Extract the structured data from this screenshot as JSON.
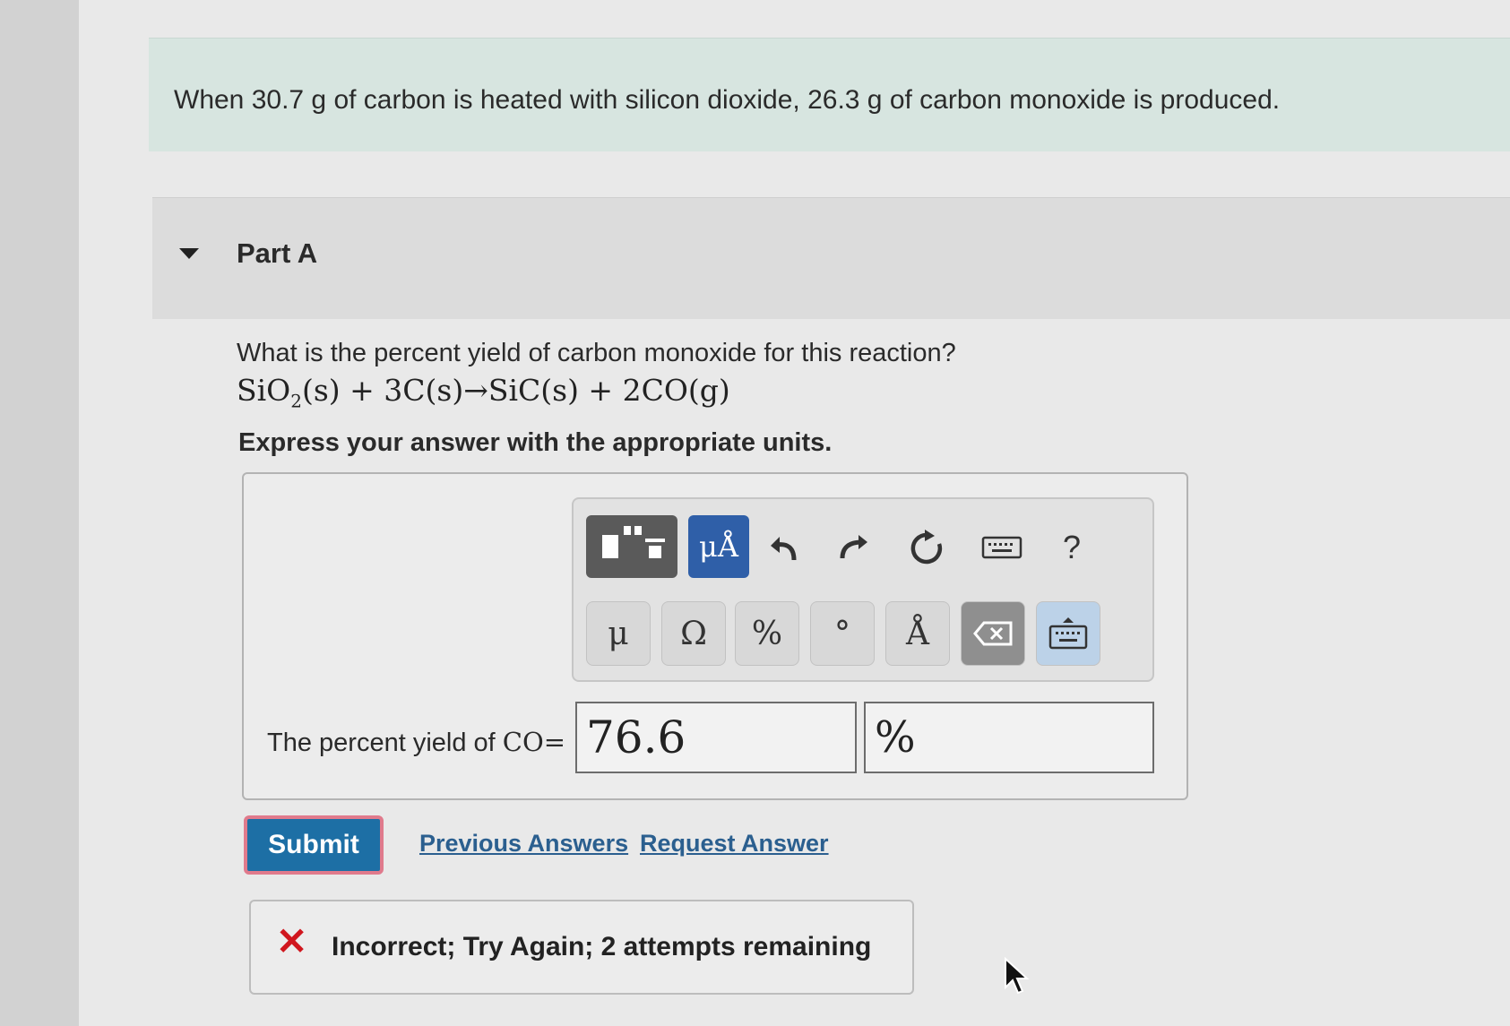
{
  "problem": {
    "text": "When 30.7 g of carbon is heated with silicon dioxide, 26.3 g of carbon monoxide is produced."
  },
  "part": {
    "title": "Part A",
    "question": "What is the percent yield of carbon monoxide for this reaction?",
    "equation_pre": "SiO",
    "equation_sub": "2",
    "equation_post": "(s) + 3C(s)→SiC(s) + 2CO(g)",
    "instructions": "Express your answer with the appropriate units."
  },
  "toolbar": {
    "units_label": "μÅ",
    "help_label": "?",
    "keys": [
      "μ",
      "Ω",
      "%",
      "°",
      "Å"
    ]
  },
  "answer": {
    "label_text": "The percent yield of ",
    "label_var": "CO=",
    "value": "76.6",
    "unit": "%"
  },
  "actions": {
    "submit_label": "Submit",
    "previous_answers_label": "Previous Answers",
    "request_answer_label": "Request Answer"
  },
  "feedback": {
    "text": "Incorrect; Try Again; 2 attempts remaining"
  },
  "colors": {
    "submit_bg": "#1d6fa5",
    "link": "#2b5f8f",
    "error": "#d0161e",
    "banner": "#d7e5e0"
  },
  "icons": [
    "templates-icon",
    "undo-icon",
    "redo-icon",
    "reset-icon",
    "keyboard-icon",
    "backspace-icon",
    "keyboard-toggle-icon",
    "cross-icon",
    "mouse-cursor-icon"
  ]
}
